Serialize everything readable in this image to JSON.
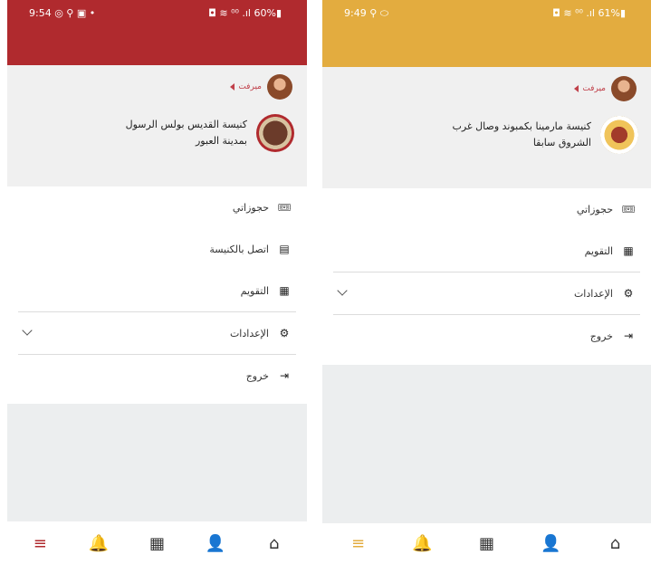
{
  "left": {
    "status": {
      "time": "9:54",
      "left_icons": "◎ ⚲ ▣ •",
      "right_text": "◘ ≋ ⁰⁰ .ıl 60%▮"
    },
    "user": {
      "name": "ميرفت"
    },
    "church": {
      "name_line1": "كنيسة القديس بولس الرسول",
      "name_line2": "بمدينة العبور"
    },
    "menu": [
      {
        "label": "حجوزاتي",
        "icon": "ticket-icon"
      },
      {
        "label": "اتصل بالكنيسة",
        "icon": "contact-card-icon"
      },
      {
        "label": "التقويم",
        "icon": "calendar-icon"
      },
      {
        "label": "الإعدادات",
        "icon": "gear-icon"
      },
      {
        "label": "خروج",
        "icon": "logout-icon"
      }
    ],
    "accent": "#b02a2e"
  },
  "right": {
    "status": {
      "time": "9:49",
      "left_icons": "⚲ ⬭",
      "right_text": "◘ ≋ ⁰⁰ .ıl 61%▮"
    },
    "user": {
      "name": "ميرفت"
    },
    "church": {
      "name_line1": "كنيسة مارمينا بكمبوند وصال غرب",
      "name_line2": "الشروق سابقا"
    },
    "menu": [
      {
        "label": "حجوزاتي",
        "icon": "ticket-icon"
      },
      {
        "label": "التقويم",
        "icon": "calendar-icon"
      },
      {
        "label": "الإعدادات",
        "icon": "gear-icon"
      },
      {
        "label": "خروج",
        "icon": "logout-icon"
      }
    ],
    "accent": "#e3ac3f"
  },
  "bottom_nav": [
    {
      "name": "menu-icon",
      "glyph": "≡"
    },
    {
      "name": "bell-icon",
      "glyph": "🔔"
    },
    {
      "name": "calendar-icon",
      "glyph": "▦"
    },
    {
      "name": "person-icon",
      "glyph": "👤"
    },
    {
      "name": "home-icon",
      "glyph": "⌂"
    }
  ]
}
